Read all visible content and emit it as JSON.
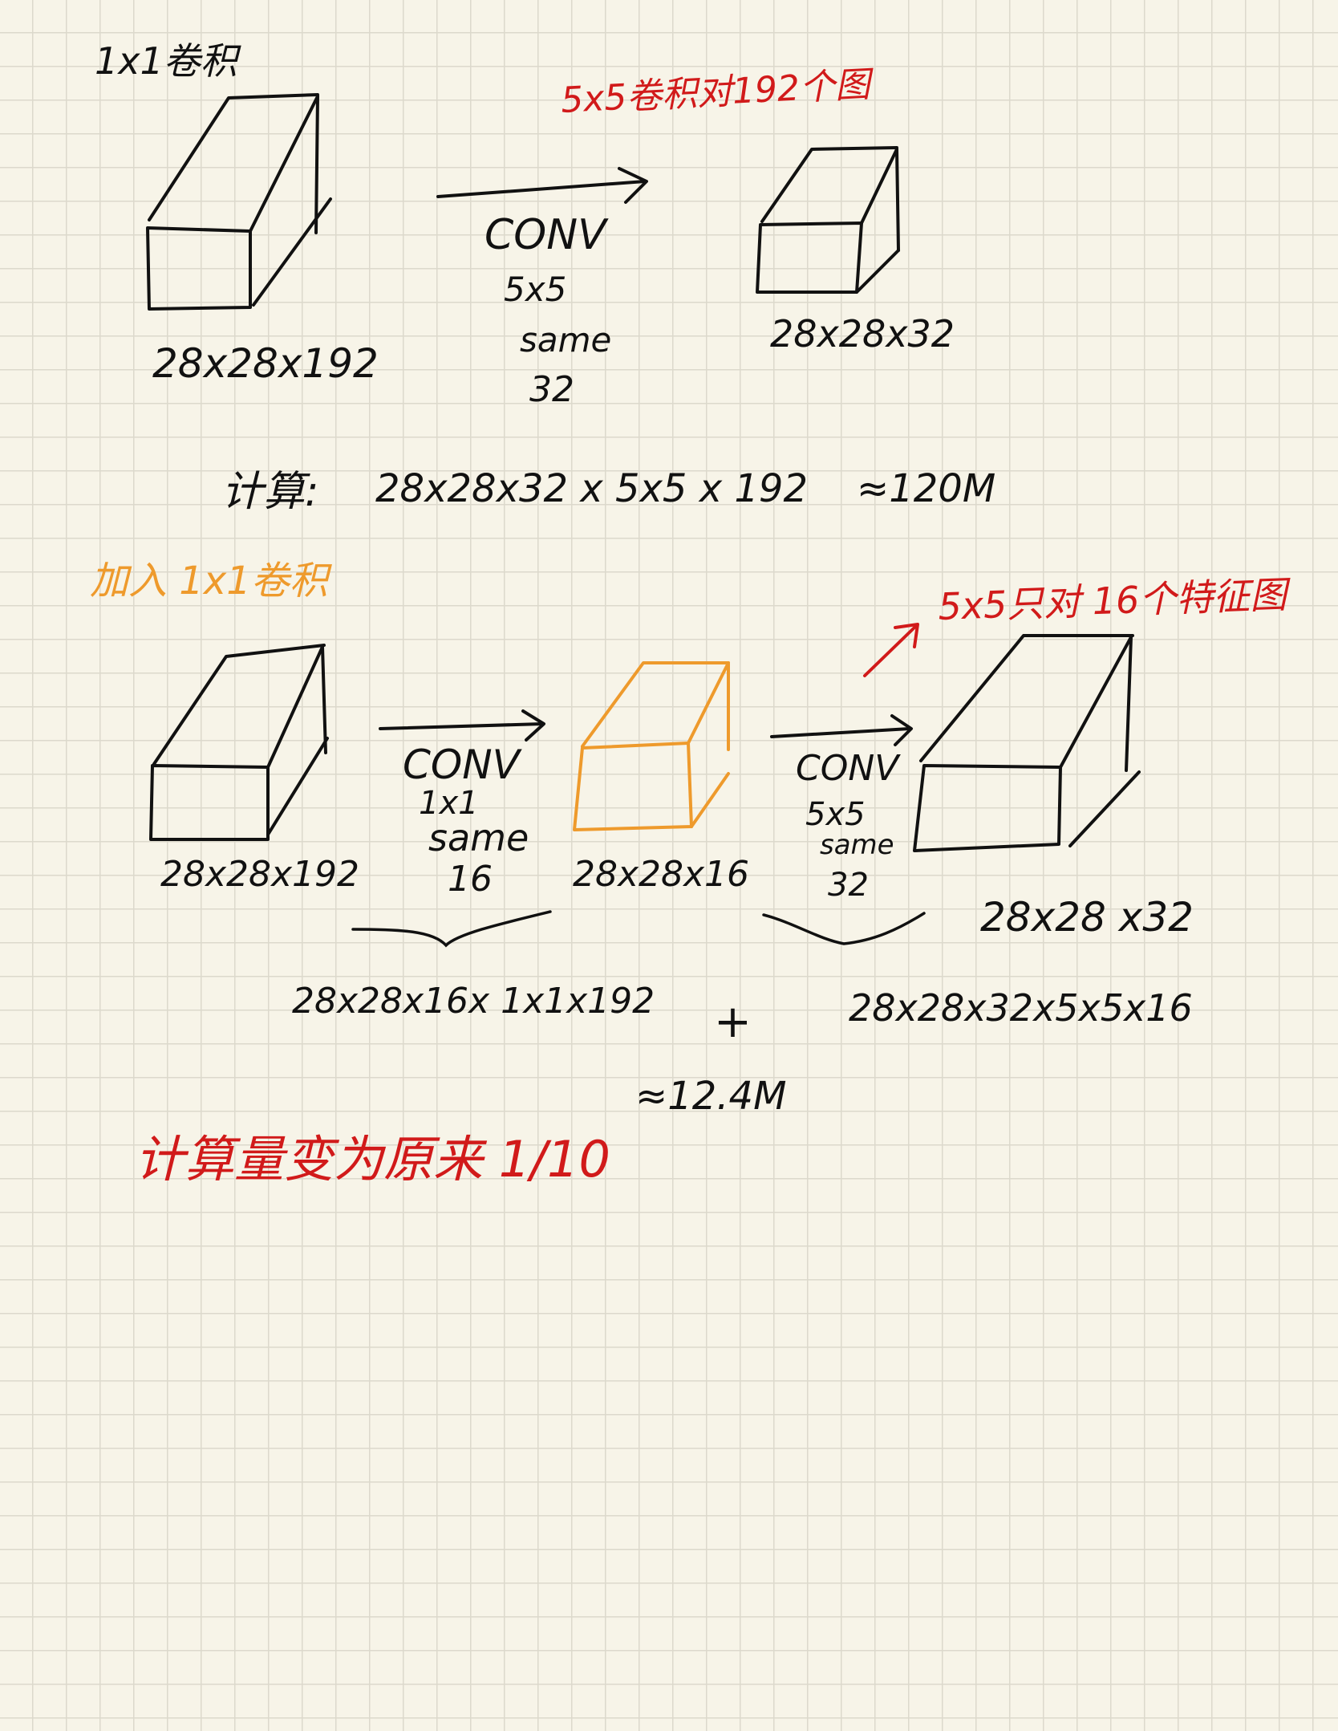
{
  "colors": {
    "ink": "#111111",
    "red": "#d11a1a",
    "orange": "#ee9a2c",
    "paper": "#f7f4e8",
    "grid": "#dcd9cc"
  },
  "section1": {
    "title": "1x1卷积",
    "note_red": "5x5卷积对192个图",
    "input_dims": "28x28x192",
    "conv_label": "CONV",
    "conv_kernel": "5x5",
    "conv_padding": "same",
    "conv_filters": "32",
    "output_dims": "28x28x32",
    "calc_prefix": "计算:",
    "calc_expr": "28x28x32 x 5x5 x 192",
    "calc_result": "≈120M"
  },
  "section2": {
    "title": "加入 1x1卷积",
    "note_red": "5x5只对 16个特征图",
    "input_dims": "28x28x192",
    "conv1_label": "CONV",
    "conv1_kernel": "1x1",
    "conv1_padding": "same",
    "conv1_filters": "16",
    "middle_dims": "28x28x16",
    "conv2_label": "CONV",
    "conv2_kernel": "5x5",
    "conv2_padding": "same",
    "conv2_filters": "32",
    "output_dims": "28x28 x32",
    "cost1": "28x28x16x 1x1x192",
    "plus": "+",
    "cost2": "28x28x32x5x5x16",
    "total": "≈12.4M",
    "conclusion": "计算量变为原来 1/10"
  }
}
